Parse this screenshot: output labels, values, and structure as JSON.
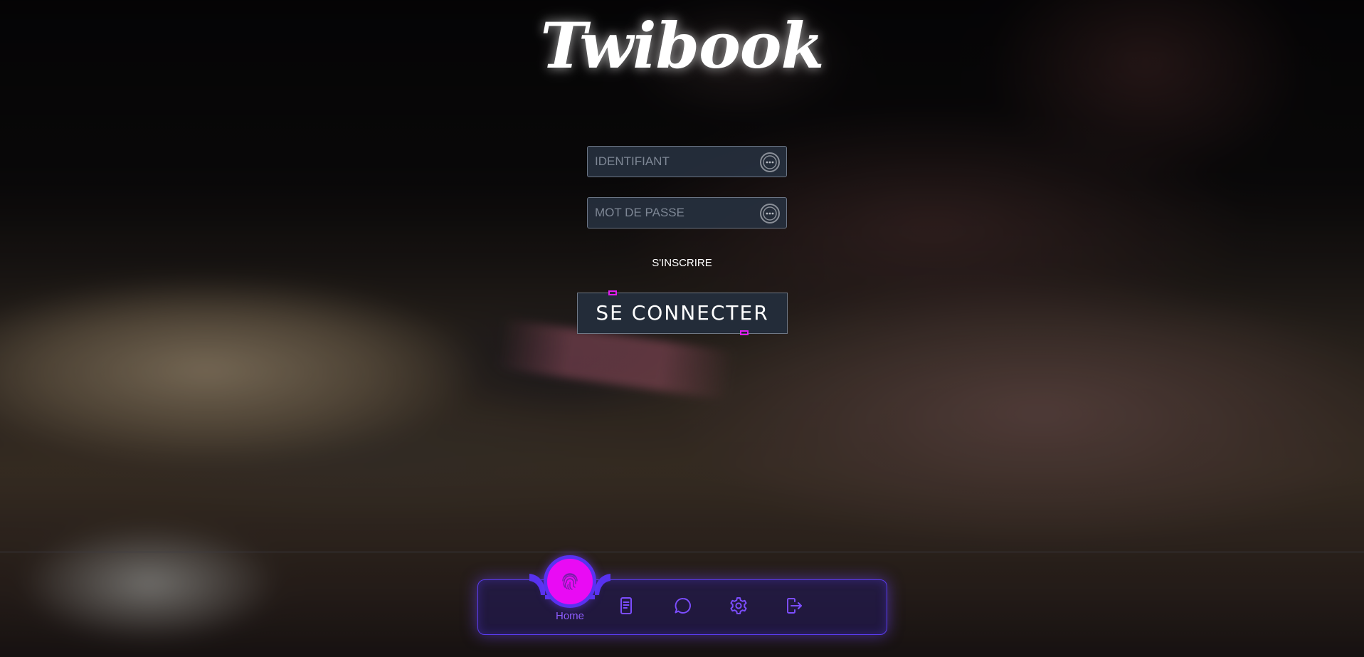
{
  "app": {
    "logo_text": "Twibook"
  },
  "login_form": {
    "username_placeholder": "IDENTIFIANT",
    "password_placeholder": "MOT DE PASSE",
    "signup_link": "S'INSCRIRE",
    "submit_label": "SE CONNECTER",
    "field_icon": "dots-circle-icon"
  },
  "nav": {
    "active_label": "Home",
    "items": [
      {
        "name": "home",
        "icon": "fingerprint-icon",
        "active": true
      },
      {
        "name": "documents",
        "icon": "document-icon",
        "active": false
      },
      {
        "name": "messages",
        "icon": "chat-bubble-icon",
        "active": false
      },
      {
        "name": "settings",
        "icon": "gear-icon",
        "active": false
      },
      {
        "name": "logout",
        "icon": "logout-icon",
        "active": false
      }
    ]
  },
  "colors": {
    "accent_magenta": "#e90bf4",
    "accent_purple": "#5832f0",
    "nav_label": "#8d5cff",
    "field_bg": "#26303e",
    "button_bg": "#232c39"
  }
}
